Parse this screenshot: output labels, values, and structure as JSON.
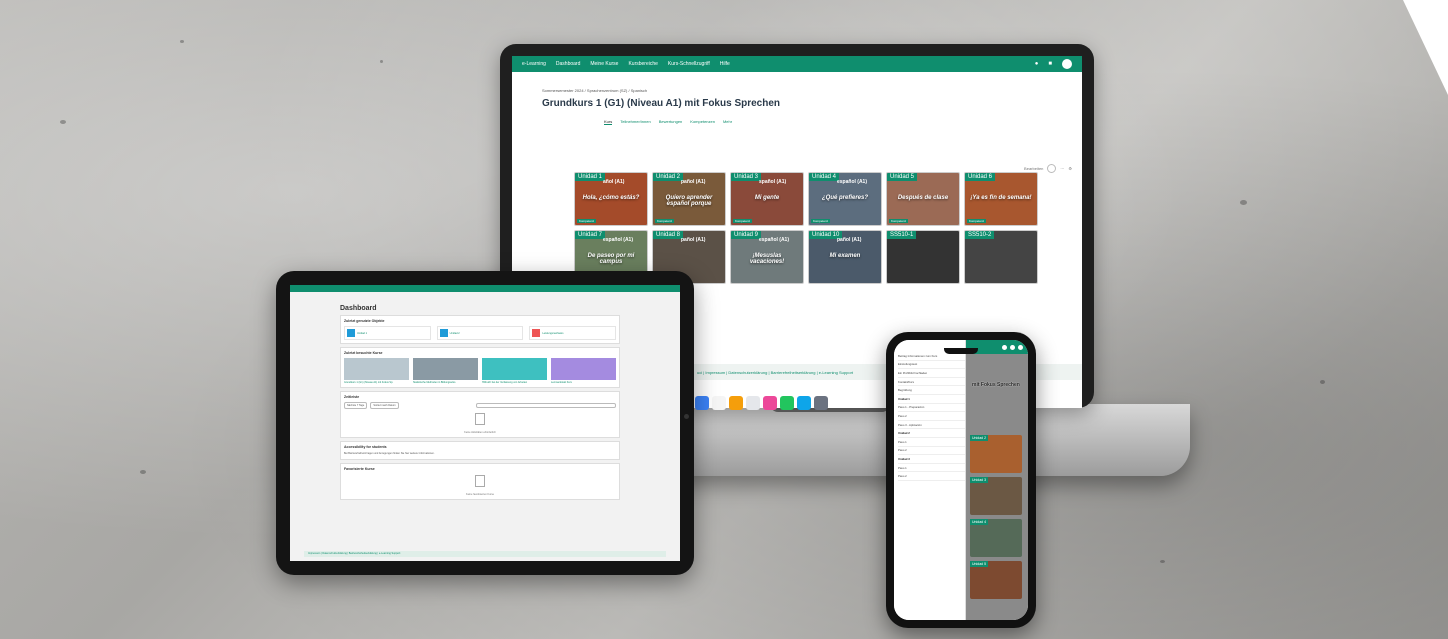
{
  "laptop": {
    "nav": {
      "brand": "e-Learning",
      "items": [
        "Dashboard",
        "Meine Kurse",
        "Kursbereiche",
        "Kurs-Schnellzugriff",
        "Hilfe"
      ]
    },
    "breadcrumb": "Sommersemester 2024 / Sprachenzentrum (SZ) / Spanisch",
    "course_title": "Grundkurs 1 (G1) (Niveau A1) mit Fokus Sprechen",
    "tabs": [
      "Kurs",
      "Teilnehmer/innen",
      "Bewertungen",
      "Kompetenzen",
      "Mehr"
    ],
    "toolbar_label": "Bearbeiten",
    "tiles": [
      {
        "unit": "Unidad 1",
        "sub": "añol (A1)",
        "mid": "Hola, ¿cómo estás?",
        "badge": "Kompetenz"
      },
      {
        "unit": "Unidad 2",
        "sub": "pañol (A1)",
        "mid": "Quiero aprender español porque",
        "badge": "Kompetenz"
      },
      {
        "unit": "Unidad 3",
        "sub": "spañol (A1)",
        "mid": "Mi gente",
        "badge": "Kompetenz"
      },
      {
        "unit": "Unidad 4",
        "sub": "español (A1)",
        "mid": "¿Qué prefieres?",
        "badge": "Kompetenz"
      },
      {
        "unit": "Unidad 5",
        "sub": "",
        "mid": "Después de clase",
        "badge": "Kompetenz"
      },
      {
        "unit": "Unidad 6",
        "sub": "",
        "mid": "¡Ya es fin de semana!",
        "badge": "Kompetenz"
      },
      {
        "unit": "Unidad 7",
        "sub": "español (A1)",
        "mid": "De paseo por mi campus",
        "badge": ""
      },
      {
        "unit": "Unidad 8",
        "sub": "pañol (A1)",
        "mid": "",
        "badge": ""
      },
      {
        "unit": "Unidad 9",
        "sub": "español (A1)",
        "mid": "¡Mesuslas vacaciones!",
        "badge": ""
      },
      {
        "unit": "Unidad 10",
        "sub": "pañol (A1)",
        "mid": "Mi examen",
        "badge": ""
      },
      {
        "unit": "SS510-1",
        "sub": "",
        "mid": "",
        "badge": ""
      },
      {
        "unit": "SS510-2",
        "sub": "",
        "mid": "",
        "badge": ""
      }
    ],
    "footer": "uci | Impressum | Datenschutzerklärung | Barrierefreiheitserklärung | e-Learning Support"
  },
  "tablet": {
    "title": "Dashboard",
    "recent_items_heading": "Zuletzt genutzte Objekte",
    "recent_items": [
      "Unidad 1",
      "Unidad 2",
      "Leistungsnachweis"
    ],
    "recent_courses_heading": "Zuletzt besuchte Kurse",
    "recent_courses": [
      "Grundkurs 1 (G1) (Niveau A1) mit Fokus Sp.",
      "Statistische Methoden in Bildungswiss.",
      "Hilfreich bei der Verfassung von Arbeiten",
      "Lernwerkstatt Kurs"
    ],
    "timeline_heading": "Zeitleiste",
    "timeline_filters": [
      "Nächste 7 Tage",
      "Sortiert nach Datum"
    ],
    "timeline_empty": "Keine Aktivitäten erforderlich",
    "accessibility_heading": "Accessibility for students",
    "accessibility_text": "Bei Barrierefreiheit-Fragen und Anregungen finden Sie hier weitere Informationen.",
    "starred_heading": "Favorisierte Kurse",
    "starred_empty": "Keine favorisierten Kurse",
    "footer": "Impressum | Datenschutzerklärung | Barrierefreiheitserklärung | e-Learning Support"
  },
  "phone": {
    "drawer_items": [
      "Beitrag Informationen zum Kurs",
      "Einstufungstest",
      "Ein Profilbild hochladen",
      "Kontakt/Kurs",
      "Begrüßung",
      "Unidad 1",
      "Paso 1 - Preparación",
      "Paso 2",
      "Paso 3 - Aplicación",
      "Unidad 2",
      "Paso 1",
      "Paso 2",
      "Unidad 3",
      "Paso 1",
      "Paso 2"
    ],
    "drawer_sections": [
      "Unidad 1",
      "Unidad 2",
      "Unidad 3"
    ],
    "course_title": "mit Fokus Sprechen",
    "tiles": [
      "Unidad 2",
      "Unidad 3",
      "Unidad 4",
      "Unidad 5"
    ]
  },
  "colors": {
    "accent": "#0f8e6e"
  }
}
